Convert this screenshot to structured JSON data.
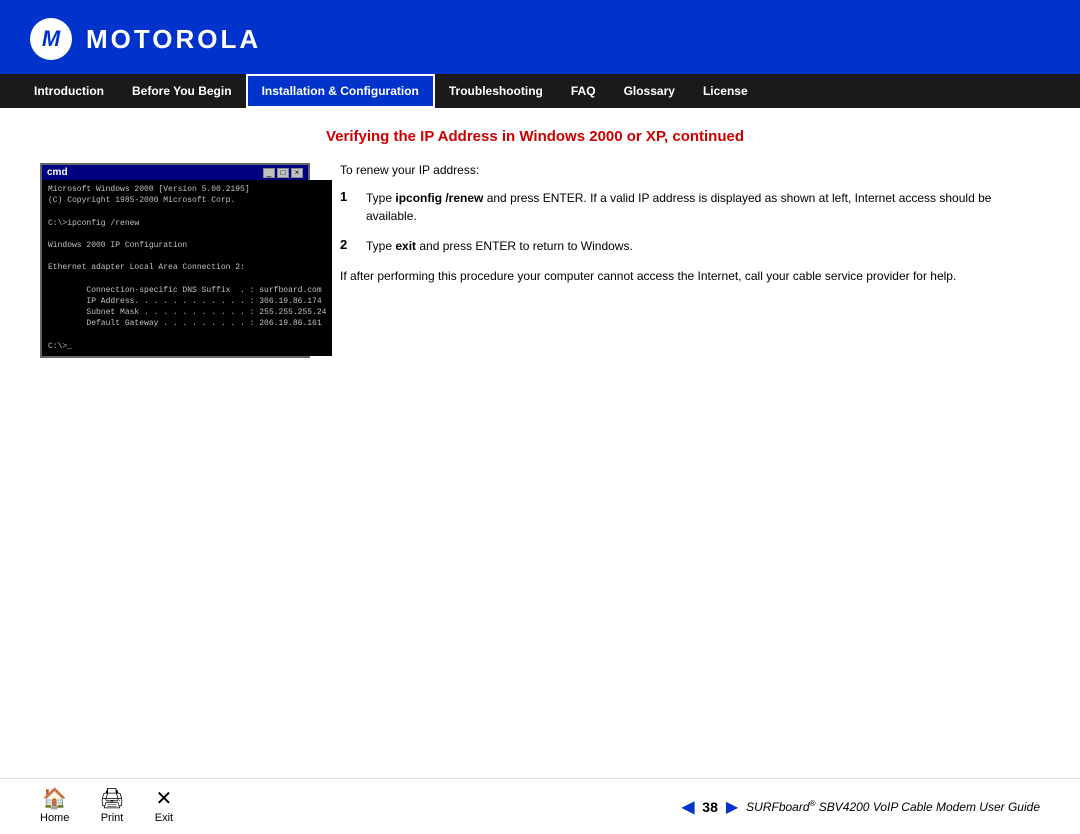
{
  "header": {
    "brand": "MOTOROLA",
    "logo_symbol": "M"
  },
  "nav": {
    "items": [
      {
        "id": "introduction",
        "label": "Introduction",
        "active": false
      },
      {
        "id": "before-you-begin",
        "label": "Before You Begin",
        "active": false
      },
      {
        "id": "installation-configuration",
        "label": "Installation & Configuration",
        "active": true
      },
      {
        "id": "troubleshooting",
        "label": "Troubleshooting",
        "active": false
      },
      {
        "id": "faq",
        "label": "FAQ",
        "active": false
      },
      {
        "id": "glossary",
        "label": "Glossary",
        "active": false
      },
      {
        "id": "license",
        "label": "License",
        "active": false
      }
    ]
  },
  "page": {
    "title": "Verifying the IP Address in Windows  2000 or XP, continued",
    "renew_label": "To renew your IP address:",
    "steps": [
      {
        "number": "1",
        "text_before": "Type ",
        "bold": "ipconfig /renew",
        "text_after": " and press ENTER. If a valid IP address is displayed as shown at left, Internet access should be available."
      },
      {
        "number": "2",
        "text_before": "Type ",
        "bold": "exit",
        "text_after": " and press ENTER to return to Windows."
      }
    ],
    "note": "If after performing this procedure your computer cannot access the Internet, call your cable service provider for help.",
    "cmd_content": "Microsoft Windows 2000 [Version 5.00.2195]\n(C) Copyright 1985-2000 Microsoft Corp.\n\nC:\\>ipconfig /renew\n\nWindows 2000 IP Configuration\n\nEthernet adapter Local Area Connection 2:\n\n        Connection-specific DNS Suffix  . : surfboard.com\n        IP Address. . . . . . . . . . . . : 306.19.86.174\n        Subnet Mask . . . . . . . . . . . : 255.255.255.24\n        Default Gateway . . . . . . . . . : 206.19.86.161\n\nC:\\>_"
  },
  "footer": {
    "nav_items": [
      {
        "id": "home",
        "label": "Home",
        "icon": "🏠"
      },
      {
        "id": "print",
        "label": "Print",
        "icon": "🖨"
      },
      {
        "id": "exit",
        "label": "Exit",
        "icon": "✕"
      }
    ],
    "page_number": "38",
    "guide_title": "SURFboard® SBV4200 VoIP Cable Modem User Guide"
  }
}
